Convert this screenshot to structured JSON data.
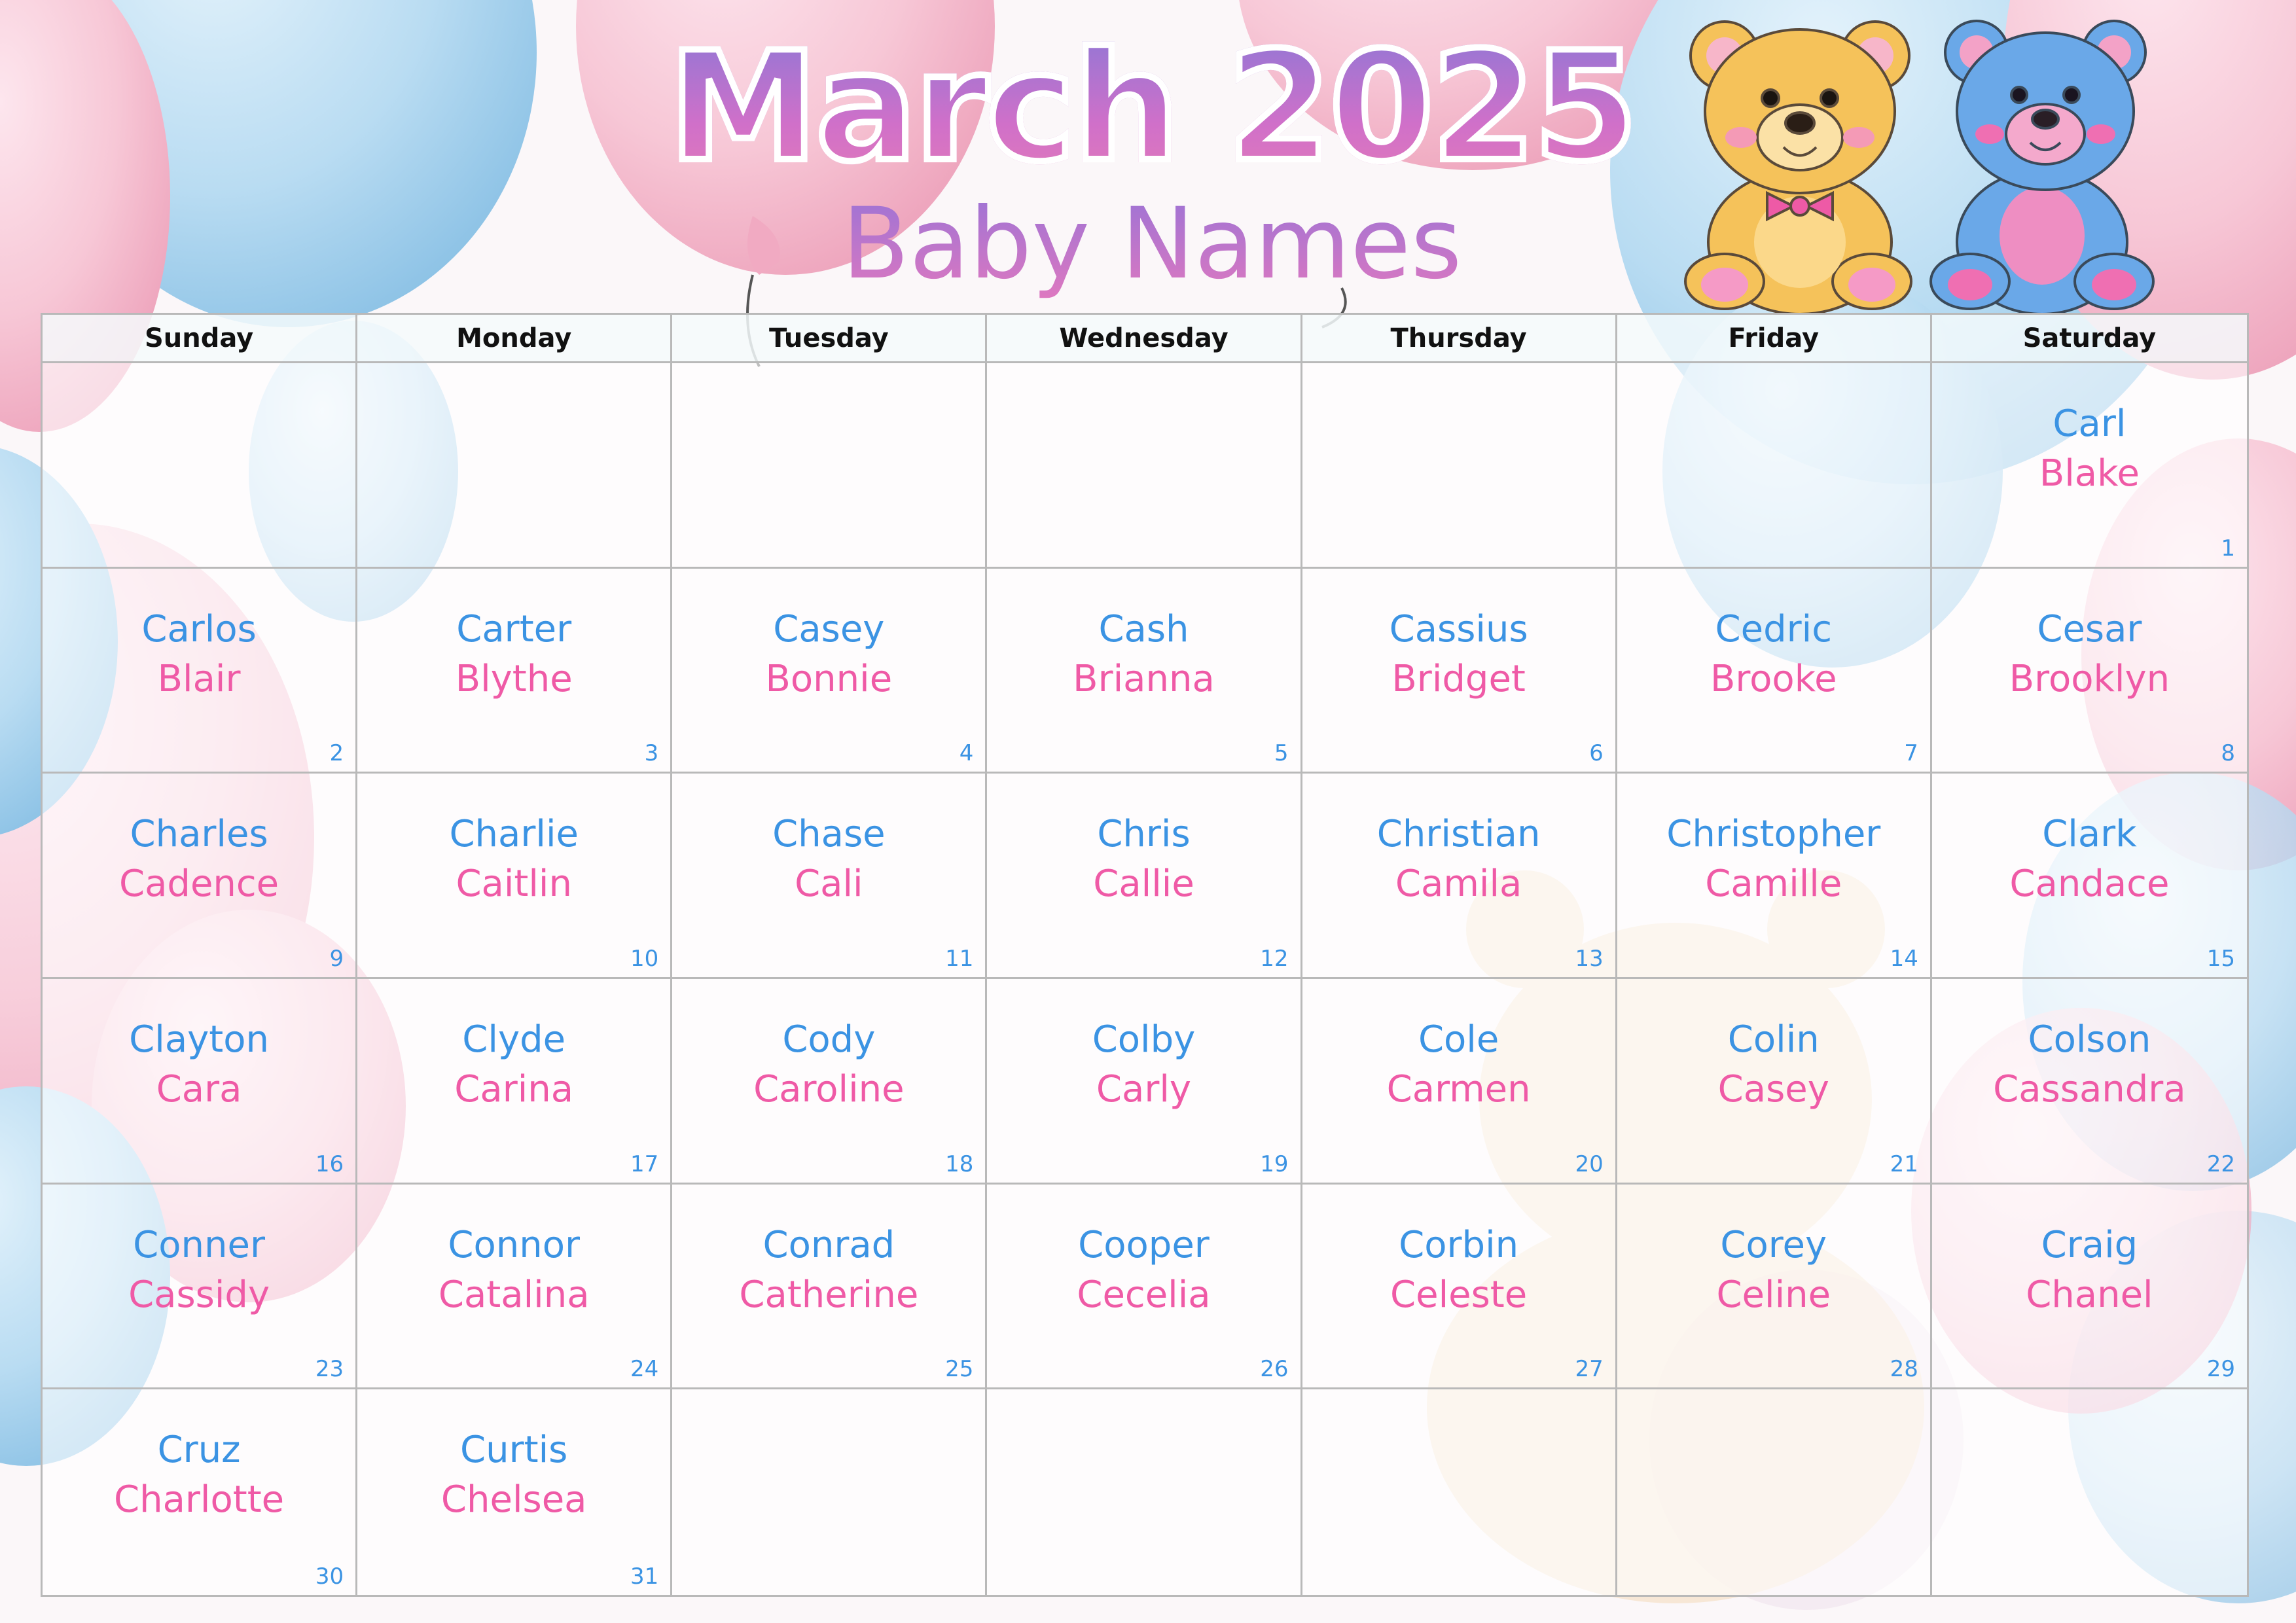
{
  "header": {
    "title": "March 2025",
    "subtitle": "Baby Names"
  },
  "calendar": {
    "weekdays": [
      "Sunday",
      "Monday",
      "Tuesday",
      "Wednesday",
      "Thursday",
      "Friday",
      "Saturday"
    ],
    "days": [
      {
        "day": "1",
        "boy": "Carl",
        "girl": "Blake"
      },
      {
        "day": "2",
        "boy": "Carlos",
        "girl": "Blair"
      },
      {
        "day": "3",
        "boy": "Carter",
        "girl": "Blythe"
      },
      {
        "day": "4",
        "boy": "Casey",
        "girl": "Bonnie"
      },
      {
        "day": "5",
        "boy": "Cash",
        "girl": "Brianna"
      },
      {
        "day": "6",
        "boy": "Cassius",
        "girl": "Bridget"
      },
      {
        "day": "7",
        "boy": "Cedric",
        "girl": "Brooke"
      },
      {
        "day": "8",
        "boy": "Cesar",
        "girl": "Brooklyn"
      },
      {
        "day": "9",
        "boy": "Charles",
        "girl": "Cadence"
      },
      {
        "day": "10",
        "boy": "Charlie",
        "girl": "Caitlin"
      },
      {
        "day": "11",
        "boy": "Chase",
        "girl": "Cali"
      },
      {
        "day": "12",
        "boy": "Chris",
        "girl": "Callie"
      },
      {
        "day": "13",
        "boy": "Christian",
        "girl": "Camila"
      },
      {
        "day": "14",
        "boy": "Christopher",
        "girl": "Camille"
      },
      {
        "day": "15",
        "boy": "Clark",
        "girl": "Candace"
      },
      {
        "day": "16",
        "boy": "Clayton",
        "girl": "Cara"
      },
      {
        "day": "17",
        "boy": "Clyde",
        "girl": "Carina"
      },
      {
        "day": "18",
        "boy": "Cody",
        "girl": "Caroline"
      },
      {
        "day": "19",
        "boy": "Colby",
        "girl": "Carly"
      },
      {
        "day": "20",
        "boy": "Cole",
        "girl": "Carmen"
      },
      {
        "day": "21",
        "boy": "Colin",
        "girl": "Casey"
      },
      {
        "day": "22",
        "boy": "Colson",
        "girl": "Cassandra"
      },
      {
        "day": "23",
        "boy": "Conner",
        "girl": "Cassidy"
      },
      {
        "day": "24",
        "boy": "Connor",
        "girl": "Catalina"
      },
      {
        "day": "25",
        "boy": "Conrad",
        "girl": "Catherine"
      },
      {
        "day": "26",
        "boy": "Cooper",
        "girl": "Cecelia"
      },
      {
        "day": "27",
        "boy": "Corbin",
        "girl": "Celeste"
      },
      {
        "day": "28",
        "boy": "Corey",
        "girl": "Celine"
      },
      {
        "day": "29",
        "boy": "Craig",
        "girl": "Chanel"
      },
      {
        "day": "30",
        "boy": "Cruz",
        "girl": "Charlotte"
      },
      {
        "day": "31",
        "boy": "Curtis",
        "girl": "Chelsea"
      }
    ]
  },
  "colors": {
    "boy_name": "#3b93e3",
    "girl_name": "#ef5aa6",
    "day_number": "#3b93e3",
    "grid_line": "#b9b9b9"
  },
  "decor": {
    "icons": [
      "balloon-blue",
      "balloon-pink",
      "teddy-bear-yellow",
      "teddy-bear-blue"
    ]
  }
}
